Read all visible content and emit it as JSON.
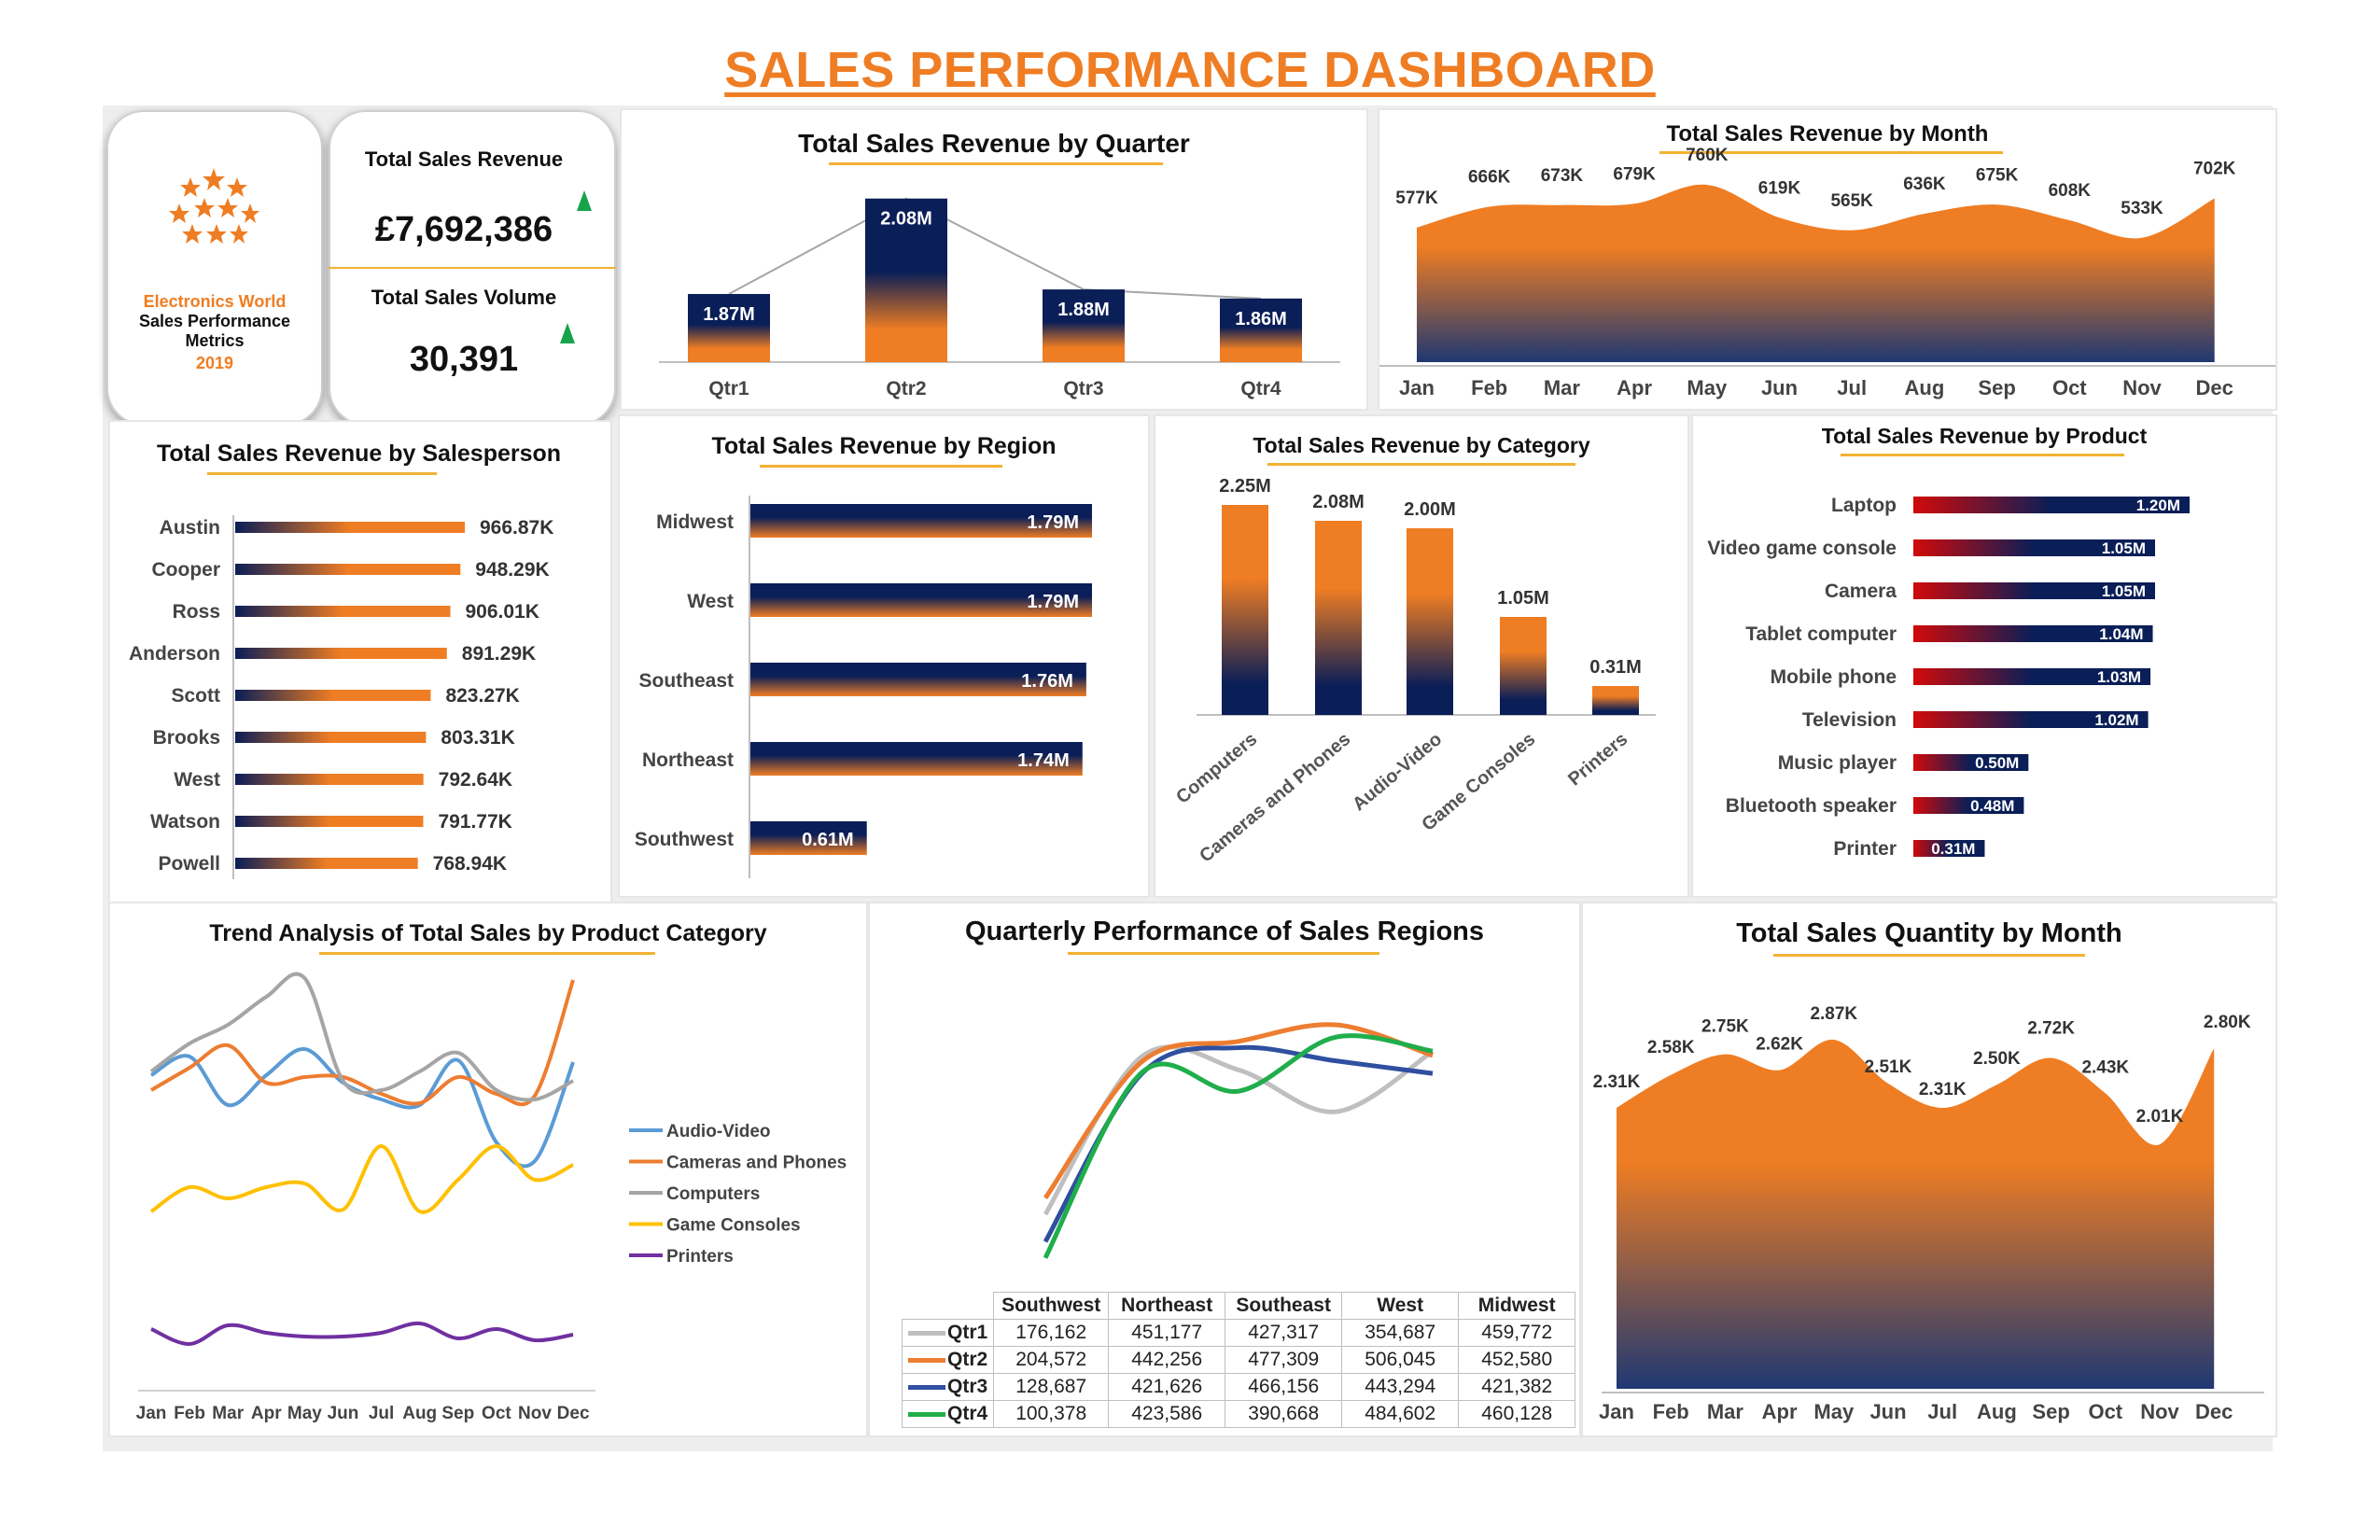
{
  "title": "SALES PERFORMANCE DASHBOARD",
  "brand": {
    "company": "Electronics World",
    "subtitle": "Sales Performance Metrics",
    "year": "2019",
    "accent": "#ef7d23",
    "navy": "#0a1e57"
  },
  "kpi": {
    "revenue_label": "Total Sales Revenue",
    "revenue_value": "£7,692,386",
    "volume_label": "Total Sales Volume",
    "volume_value": "30,391"
  },
  "chart_data": [
    {
      "id": "quarter",
      "type": "bar",
      "title": "Total Sales Revenue by Quarter",
      "categories": [
        "Qtr1",
        "Qtr2",
        "Qtr3",
        "Qtr4"
      ],
      "values": [
        1.87,
        2.08,
        1.88,
        1.86
      ],
      "labels": [
        "1.87M",
        "2.08M",
        "1.88M",
        "1.86M"
      ],
      "ylim": [
        1.72,
        2.1
      ]
    },
    {
      "id": "month",
      "type": "area",
      "title": "Total Sales Revenue by Month",
      "categories": [
        "Jan",
        "Feb",
        "Mar",
        "Apr",
        "May",
        "Jun",
        "Jul",
        "Aug",
        "Sep",
        "Oct",
        "Nov",
        "Dec"
      ],
      "values": [
        577,
        666,
        673,
        679,
        760,
        619,
        565,
        636,
        675,
        608,
        533,
        702
      ],
      "labels": [
        "577K",
        "666K",
        "673K",
        "679K",
        "760K",
        "619K",
        "565K",
        "636K",
        "675K",
        "608K",
        "533K",
        "702K"
      ],
      "ylim": [
        0,
        800
      ]
    },
    {
      "id": "salesperson",
      "type": "bar",
      "title": "Total Sales Revenue by Salesperson",
      "categories": [
        "Austin",
        "Cooper",
        "Ross",
        "Anderson",
        "Scott",
        "Brooks",
        "West",
        "Watson",
        "Powell"
      ],
      "values": [
        966.87,
        948.29,
        906.01,
        891.29,
        823.27,
        803.31,
        792.64,
        791.77,
        768.94
      ],
      "labels": [
        "966.87K",
        "948.29K",
        "906.01K",
        "891.29K",
        "823.27K",
        "803.31K",
        "792.64K",
        "791.77K",
        "768.94K"
      ]
    },
    {
      "id": "region",
      "type": "bar",
      "title": "Total Sales Revenue by Region",
      "categories": [
        "Midwest",
        "West",
        "Southeast",
        "Northeast",
        "Southwest"
      ],
      "values": [
        1.79,
        1.79,
        1.76,
        1.74,
        0.61
      ],
      "labels": [
        "1.79M",
        "1.79M",
        "1.76M",
        "1.74M",
        "0.61M"
      ]
    },
    {
      "id": "category",
      "type": "bar",
      "title": "Total Sales Revenue by Category",
      "categories": [
        "Computers",
        "Cameras and Phones",
        "Audio-Video",
        "Game Consoles",
        "Printers"
      ],
      "values": [
        2.25,
        2.08,
        2.0,
        1.05,
        0.31
      ],
      "labels": [
        "2.25M",
        "2.08M",
        "2.00M",
        "1.05M",
        "0.31M"
      ]
    },
    {
      "id": "product",
      "type": "bar",
      "title": "Total Sales Revenue by Product",
      "categories": [
        "Laptop",
        "Video game console",
        "Camera",
        "Tablet computer",
        "Mobile phone",
        "Television",
        "Music player",
        "Bluetooth speaker",
        "Printer"
      ],
      "values": [
        1.2,
        1.05,
        1.05,
        1.04,
        1.03,
        1.02,
        0.5,
        0.48,
        0.31
      ],
      "labels": [
        "1.20M",
        "1.05M",
        "1.05M",
        "1.04M",
        "1.03M",
        "1.02M",
        "0.50M",
        "0.48M",
        "0.31M"
      ]
    },
    {
      "id": "trend",
      "type": "line",
      "title": "Trend Analysis of Total Sales by Product Category",
      "categories": [
        "Jan",
        "Feb",
        "Mar",
        "Apr",
        "May",
        "Jun",
        "Jul",
        "Aug",
        "Sep",
        "Oct",
        "Nov",
        "Dec"
      ],
      "series": [
        {
          "name": "Audio-Video",
          "color": "#5b9bd5",
          "values": [
            168,
            178,
            152,
            168,
            182,
            164,
            155,
            152,
            176,
            132,
            122,
            175
          ]
        },
        {
          "name": "Cameras and Phones",
          "color": "#ed7d31",
          "values": [
            160,
            172,
            184,
            164,
            167,
            167,
            158,
            153,
            167,
            158,
            157,
            219
          ]
        },
        {
          "name": "Computers",
          "color": "#a5a5a5",
          "values": [
            170,
            185,
            195,
            210,
            220,
            165,
            160,
            170,
            180,
            160,
            155,
            165
          ]
        },
        {
          "name": "Game Consoles",
          "color": "#ffc000",
          "values": [
            95,
            108,
            102,
            108,
            110,
            96,
            130,
            95,
            112,
            130,
            112,
            120
          ]
        },
        {
          "name": "Printers",
          "color": "#7030a0",
          "values": [
            32,
            24,
            34,
            30,
            28,
            28,
            30,
            35,
            27,
            32,
            26,
            29
          ]
        }
      ]
    },
    {
      "id": "regions_quarterly",
      "type": "line",
      "title": "Quarterly Performance of Sales Regions",
      "categories": [
        "Southwest",
        "Northeast",
        "Southeast",
        "West",
        "Midwest"
      ],
      "series": [
        {
          "name": "Qtr1",
          "color": "#bfbfbf",
          "values": [
            176162,
            451177,
            427317,
            354687,
            459772
          ]
        },
        {
          "name": "Qtr2",
          "color": "#ed7d31",
          "values": [
            204572,
            442256,
            477309,
            506045,
            452580
          ]
        },
        {
          "name": "Qtr3",
          "color": "#2f4fa0",
          "values": [
            128687,
            421626,
            466156,
            443294,
            421382
          ]
        },
        {
          "name": "Qtr4",
          "color": "#1fae4b",
          "values": [
            100378,
            423586,
            390668,
            484602,
            460128
          ]
        }
      ],
      "table": [
        [
          "176,162",
          "451,177",
          "427,317",
          "354,687",
          "459,772"
        ],
        [
          "204,572",
          "442,256",
          "477,309",
          "506,045",
          "452,580"
        ],
        [
          "128,687",
          "421,626",
          "466,156",
          "443,294",
          "421,382"
        ],
        [
          "100,378",
          "423,586",
          "390,668",
          "484,602",
          "460,128"
        ]
      ]
    },
    {
      "id": "quantity",
      "type": "area",
      "title": "Total Sales Quantity by Month",
      "categories": [
        "Jan",
        "Feb",
        "Mar",
        "Apr",
        "May",
        "Jun",
        "Jul",
        "Aug",
        "Sep",
        "Oct",
        "Nov",
        "Dec"
      ],
      "values": [
        2.31,
        2.58,
        2.75,
        2.62,
        2.87,
        2.51,
        2.31,
        2.5,
        2.72,
        2.43,
        2.01,
        2.8
      ],
      "labels": [
        "2.31K",
        "2.58K",
        "2.75K",
        "2.62K",
        "2.87K",
        "2.51K",
        "2.31K",
        "2.50K",
        "2.72K",
        "2.43K",
        "2.01K",
        "2.80K"
      ],
      "ylim": [
        0,
        3.2
      ]
    }
  ]
}
